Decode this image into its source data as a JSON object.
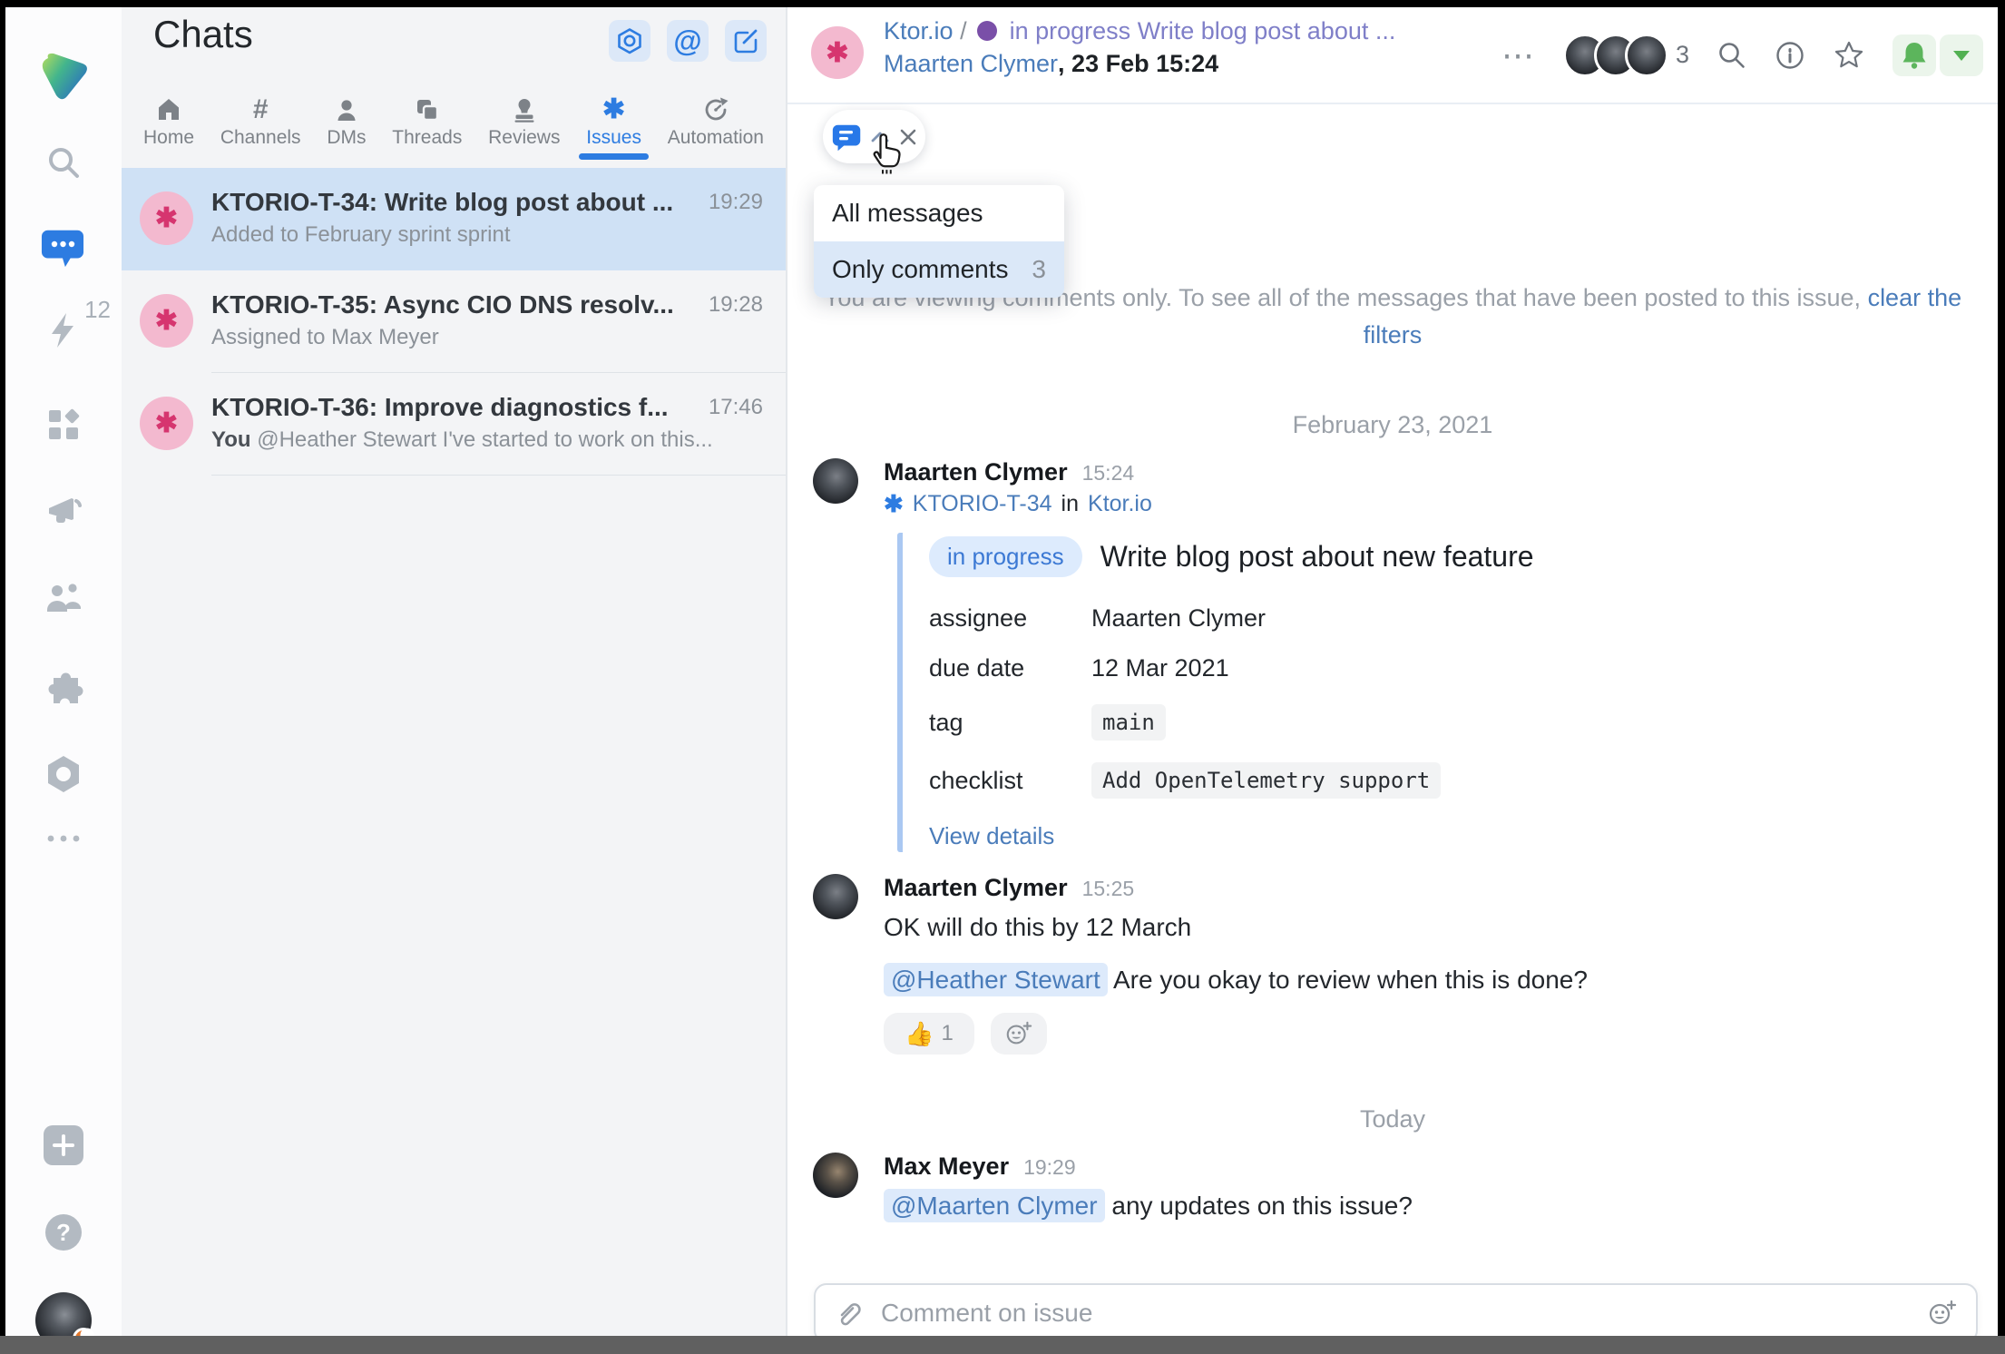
{
  "glyphs": {
    "asterisk": "✱",
    "hash": "#",
    "at": "@",
    "ellipsis": "⋯",
    "question": "?",
    "plus": "+",
    "thumb": "👍"
  },
  "colors": {
    "accent_blue": "#2d7ce1",
    "accent_green": "#5cb55c",
    "avatar_pink_bg": "#f3b9cf",
    "avatar_pink_fg": "#d6356f",
    "status_purple": "#7a4fa8",
    "mention_bg": "#ddeafb",
    "selected_row": "#cfe1f5"
  },
  "sidebar": {
    "flash_count": "12"
  },
  "chats": {
    "title": "Chats",
    "tabs": [
      {
        "label": "Home"
      },
      {
        "label": "Channels"
      },
      {
        "label": "DMs"
      },
      {
        "label": "Threads"
      },
      {
        "label": "Reviews"
      },
      {
        "label": "Issues"
      },
      {
        "label": "Automation"
      }
    ],
    "items": [
      {
        "title": "KTORIO-T-34: Write blog post about ...",
        "time": "19:29",
        "subtitle_prefix": "",
        "subtitle": "Added to February sprint sprint"
      },
      {
        "title": "KTORIO-T-35: Async CIO DNS resolv...",
        "time": "19:28",
        "subtitle_prefix": "",
        "subtitle": "Assigned to Max Meyer"
      },
      {
        "title": "KTORIO-T-36: Improve diagnostics f...",
        "time": "17:46",
        "subtitle_prefix": "You",
        "subtitle": " @Heather Stewart I've started to work on this..."
      }
    ]
  },
  "header": {
    "project": "Ktor.io",
    "slash": "/",
    "status": "in progress",
    "title": "Write blog post about ...",
    "author": "Maarten Clymer",
    "meta": ", 23 Feb 15:24",
    "participants_count": "3"
  },
  "filter_menu": {
    "items": [
      {
        "label": "All messages",
        "count": ""
      },
      {
        "label": "Only comments",
        "count": "3"
      }
    ]
  },
  "notice": {
    "prefix": "You are viewing comments only. To see all of the messages that have been posted to this issue, ",
    "link_start": "clear the",
    "link_end": "filters"
  },
  "conversation": {
    "date1": "February 23, 2021",
    "date2": "Today",
    "msg1": {
      "author": "Maarten Clymer",
      "time": "15:24",
      "ref_key": "KTORIO-T-34",
      "ref_in": "in",
      "ref_project": "Ktor.io",
      "card": {
        "status": "in progress",
        "title": "Write blog post about new feature",
        "fields": [
          {
            "label": "assignee",
            "value": "Maarten Clymer"
          },
          {
            "label": "due date",
            "value": "12 Mar 2021"
          },
          {
            "label": "tag",
            "value": "main"
          },
          {
            "label": "checklist",
            "value": "Add OpenTelemetry support"
          }
        ],
        "link": "View details"
      }
    },
    "msg2": {
      "author": "Maarten Clymer",
      "time": "15:25",
      "text1": "OK will do this by 12 March",
      "mention": "@Heather Stewart",
      "text2": "Are you okay to review when this is done?",
      "reaction_count": "1"
    },
    "msg3": {
      "author": "Max Meyer",
      "time": "19:29",
      "mention": "@Maarten Clymer",
      "text": "any updates on this issue?"
    }
  },
  "composer": {
    "placeholder": "Comment on issue"
  }
}
